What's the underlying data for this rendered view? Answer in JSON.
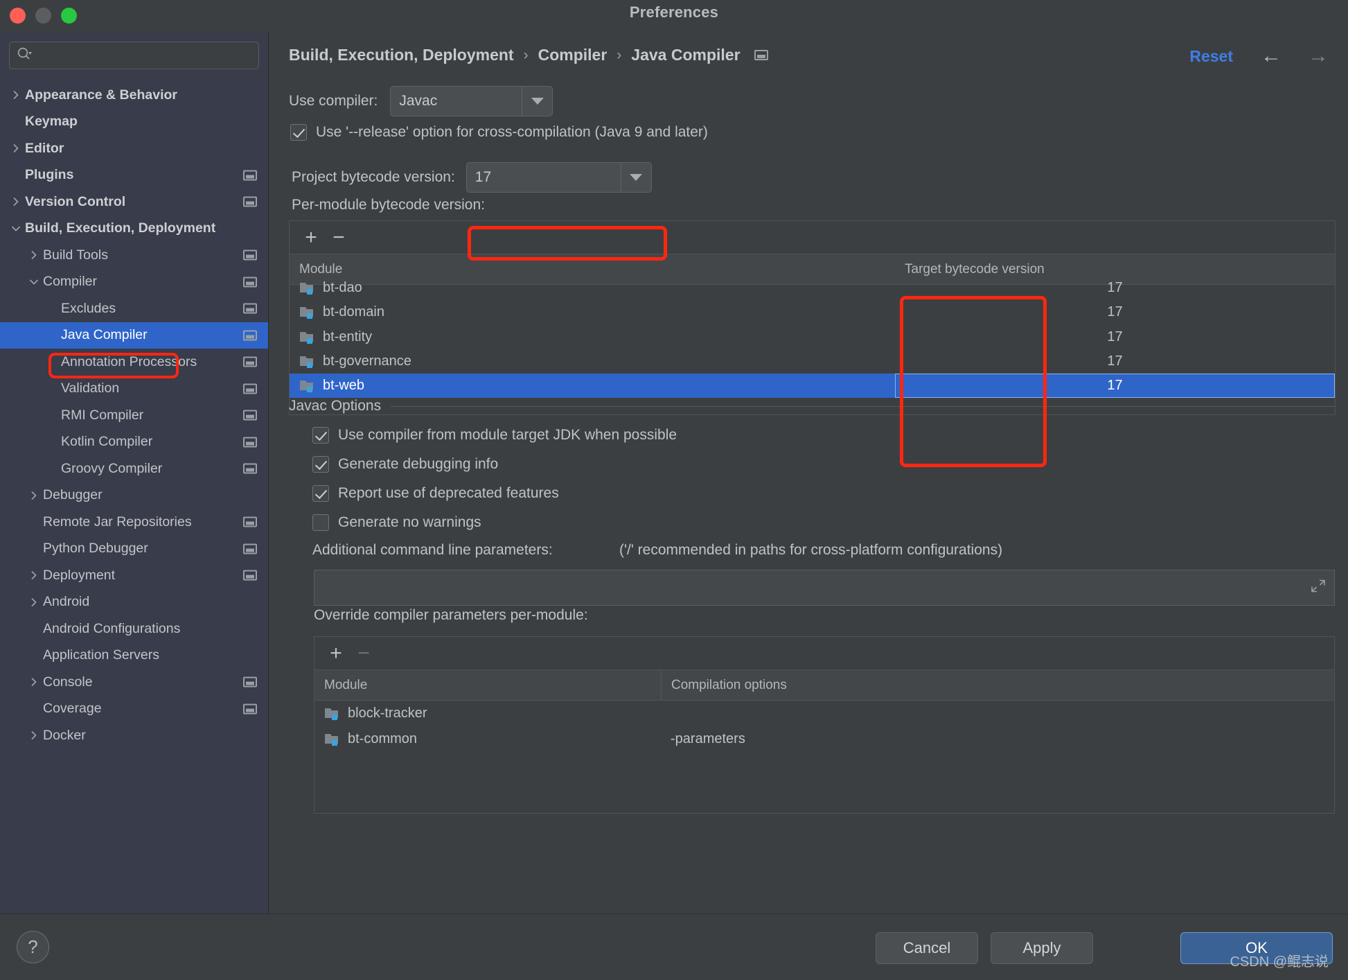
{
  "window": {
    "title": "Preferences",
    "traffic_lights": [
      "close-red",
      "minimize-yellow",
      "zoom-green"
    ]
  },
  "sidebar": {
    "search": {
      "value": "",
      "placeholder": ""
    },
    "items": [
      {
        "label": "Appearance & Behavior",
        "twisty": "chevron-right",
        "indent": 0,
        "bold": true,
        "badge": false,
        "selected": false
      },
      {
        "label": "Keymap",
        "twisty": "none",
        "indent": 0,
        "bold": true,
        "badge": false,
        "selected": false
      },
      {
        "label": "Editor",
        "twisty": "chevron-right",
        "indent": 0,
        "bold": true,
        "badge": false,
        "selected": false
      },
      {
        "label": "Plugins",
        "twisty": "none",
        "indent": 0,
        "bold": true,
        "badge": true,
        "selected": false
      },
      {
        "label": "Version Control",
        "twisty": "chevron-right",
        "indent": 0,
        "bold": true,
        "badge": true,
        "selected": false
      },
      {
        "label": "Build, Execution, Deployment",
        "twisty": "chevron-down",
        "indent": 0,
        "bold": true,
        "badge": false,
        "selected": false
      },
      {
        "label": "Build Tools",
        "twisty": "chevron-right",
        "indent": 1,
        "bold": false,
        "badge": true,
        "selected": false
      },
      {
        "label": "Compiler",
        "twisty": "chevron-down",
        "indent": 1,
        "bold": false,
        "badge": true,
        "selected": false
      },
      {
        "label": "Excludes",
        "twisty": "none",
        "indent": 2,
        "bold": false,
        "badge": true,
        "selected": false
      },
      {
        "label": "Java Compiler",
        "twisty": "none",
        "indent": 2,
        "bold": false,
        "badge": true,
        "selected": true
      },
      {
        "label": "Annotation Processors",
        "twisty": "none",
        "indent": 2,
        "bold": false,
        "badge": true,
        "selected": false
      },
      {
        "label": "Validation",
        "twisty": "none",
        "indent": 2,
        "bold": false,
        "badge": true,
        "selected": false
      },
      {
        "label": "RMI Compiler",
        "twisty": "none",
        "indent": 2,
        "bold": false,
        "badge": true,
        "selected": false
      },
      {
        "label": "Kotlin Compiler",
        "twisty": "none",
        "indent": 2,
        "bold": false,
        "badge": true,
        "selected": false
      },
      {
        "label": "Groovy Compiler",
        "twisty": "none",
        "indent": 2,
        "bold": false,
        "badge": true,
        "selected": false
      },
      {
        "label": "Debugger",
        "twisty": "chevron-right",
        "indent": 1,
        "bold": false,
        "badge": false,
        "selected": false
      },
      {
        "label": "Remote Jar Repositories",
        "twisty": "none",
        "indent": 1,
        "bold": false,
        "badge": true,
        "selected": false
      },
      {
        "label": "Python Debugger",
        "twisty": "none",
        "indent": 1,
        "bold": false,
        "badge": true,
        "selected": false
      },
      {
        "label": "Deployment",
        "twisty": "chevron-right",
        "indent": 1,
        "bold": false,
        "badge": true,
        "selected": false
      },
      {
        "label": "Android",
        "twisty": "chevron-right",
        "indent": 1,
        "bold": false,
        "badge": false,
        "selected": false
      },
      {
        "label": "Android Configurations",
        "twisty": "none",
        "indent": 1,
        "bold": false,
        "badge": false,
        "selected": false
      },
      {
        "label": "Application Servers",
        "twisty": "none",
        "indent": 1,
        "bold": false,
        "badge": false,
        "selected": false
      },
      {
        "label": "Console",
        "twisty": "chevron-right",
        "indent": 1,
        "bold": false,
        "badge": true,
        "selected": false
      },
      {
        "label": "Coverage",
        "twisty": "none",
        "indent": 1,
        "bold": false,
        "badge": true,
        "selected": false
      },
      {
        "label": "Docker",
        "twisty": "chevron-right",
        "indent": 1,
        "bold": false,
        "badge": false,
        "selected": false
      }
    ]
  },
  "header": {
    "breadcrumb": [
      "Build, Execution, Deployment",
      "Compiler",
      "Java Compiler"
    ],
    "separator": "›",
    "reset_label": "Reset",
    "back_arrow": "←",
    "forward_arrow": "→"
  },
  "main": {
    "use_compiler_label": "Use compiler:",
    "use_compiler_value": "Javac",
    "release_option_label": "Use '--release' option for cross-compilation (Java 9 and later)",
    "release_option_checked": true,
    "project_bytecode_label": "Project bytecode version:",
    "project_bytecode_value": "17",
    "per_module_label": "Per-module bytecode version:",
    "module_table": {
      "add_label": "+",
      "remove_label": "−",
      "columns": [
        "Module",
        "Target bytecode version"
      ],
      "rows": [
        {
          "module": "bt-dao",
          "version": "17",
          "selected": false,
          "clipped": true
        },
        {
          "module": "bt-domain",
          "version": "17",
          "selected": false,
          "clipped": false
        },
        {
          "module": "bt-entity",
          "version": "17",
          "selected": false,
          "clipped": false
        },
        {
          "module": "bt-governance",
          "version": "17",
          "selected": false,
          "clipped": false
        },
        {
          "module": "bt-web",
          "version": "17",
          "selected": true,
          "clipped": false
        }
      ]
    },
    "javac_options_title": "Javac Options",
    "javac_checkboxes": [
      {
        "label": "Use compiler from module target JDK when possible",
        "checked": true
      },
      {
        "label": "Generate debugging info",
        "checked": true
      },
      {
        "label": "Report use of deprecated features",
        "checked": true
      },
      {
        "label": "Generate no warnings",
        "checked": false
      }
    ],
    "additional_params_label": "Additional command line parameters:",
    "additional_params_hint": "('/' recommended in paths for cross-platform configurations)",
    "additional_params_value": "",
    "override_label": "Override compiler parameters per-module:",
    "override_table": {
      "add_label": "+",
      "remove_label": "−",
      "columns": [
        "Module",
        "Compilation options"
      ],
      "rows": [
        {
          "module": "block-tracker",
          "options": ""
        },
        {
          "module": "bt-common",
          "options": "-parameters"
        }
      ]
    }
  },
  "footer": {
    "help_label": "?",
    "cancel_label": "Cancel",
    "apply_label": "Apply",
    "ok_label": "OK"
  },
  "watermark": "CSDN @鲲志说",
  "colors": {
    "accent_blue": "#2f65c9",
    "link_blue": "#3f7ee8",
    "annotation_red": "#fe2712",
    "sidebar_bg": "#383c4b",
    "panel_bg": "#3c3f41",
    "ok_button": "#3a6294"
  }
}
